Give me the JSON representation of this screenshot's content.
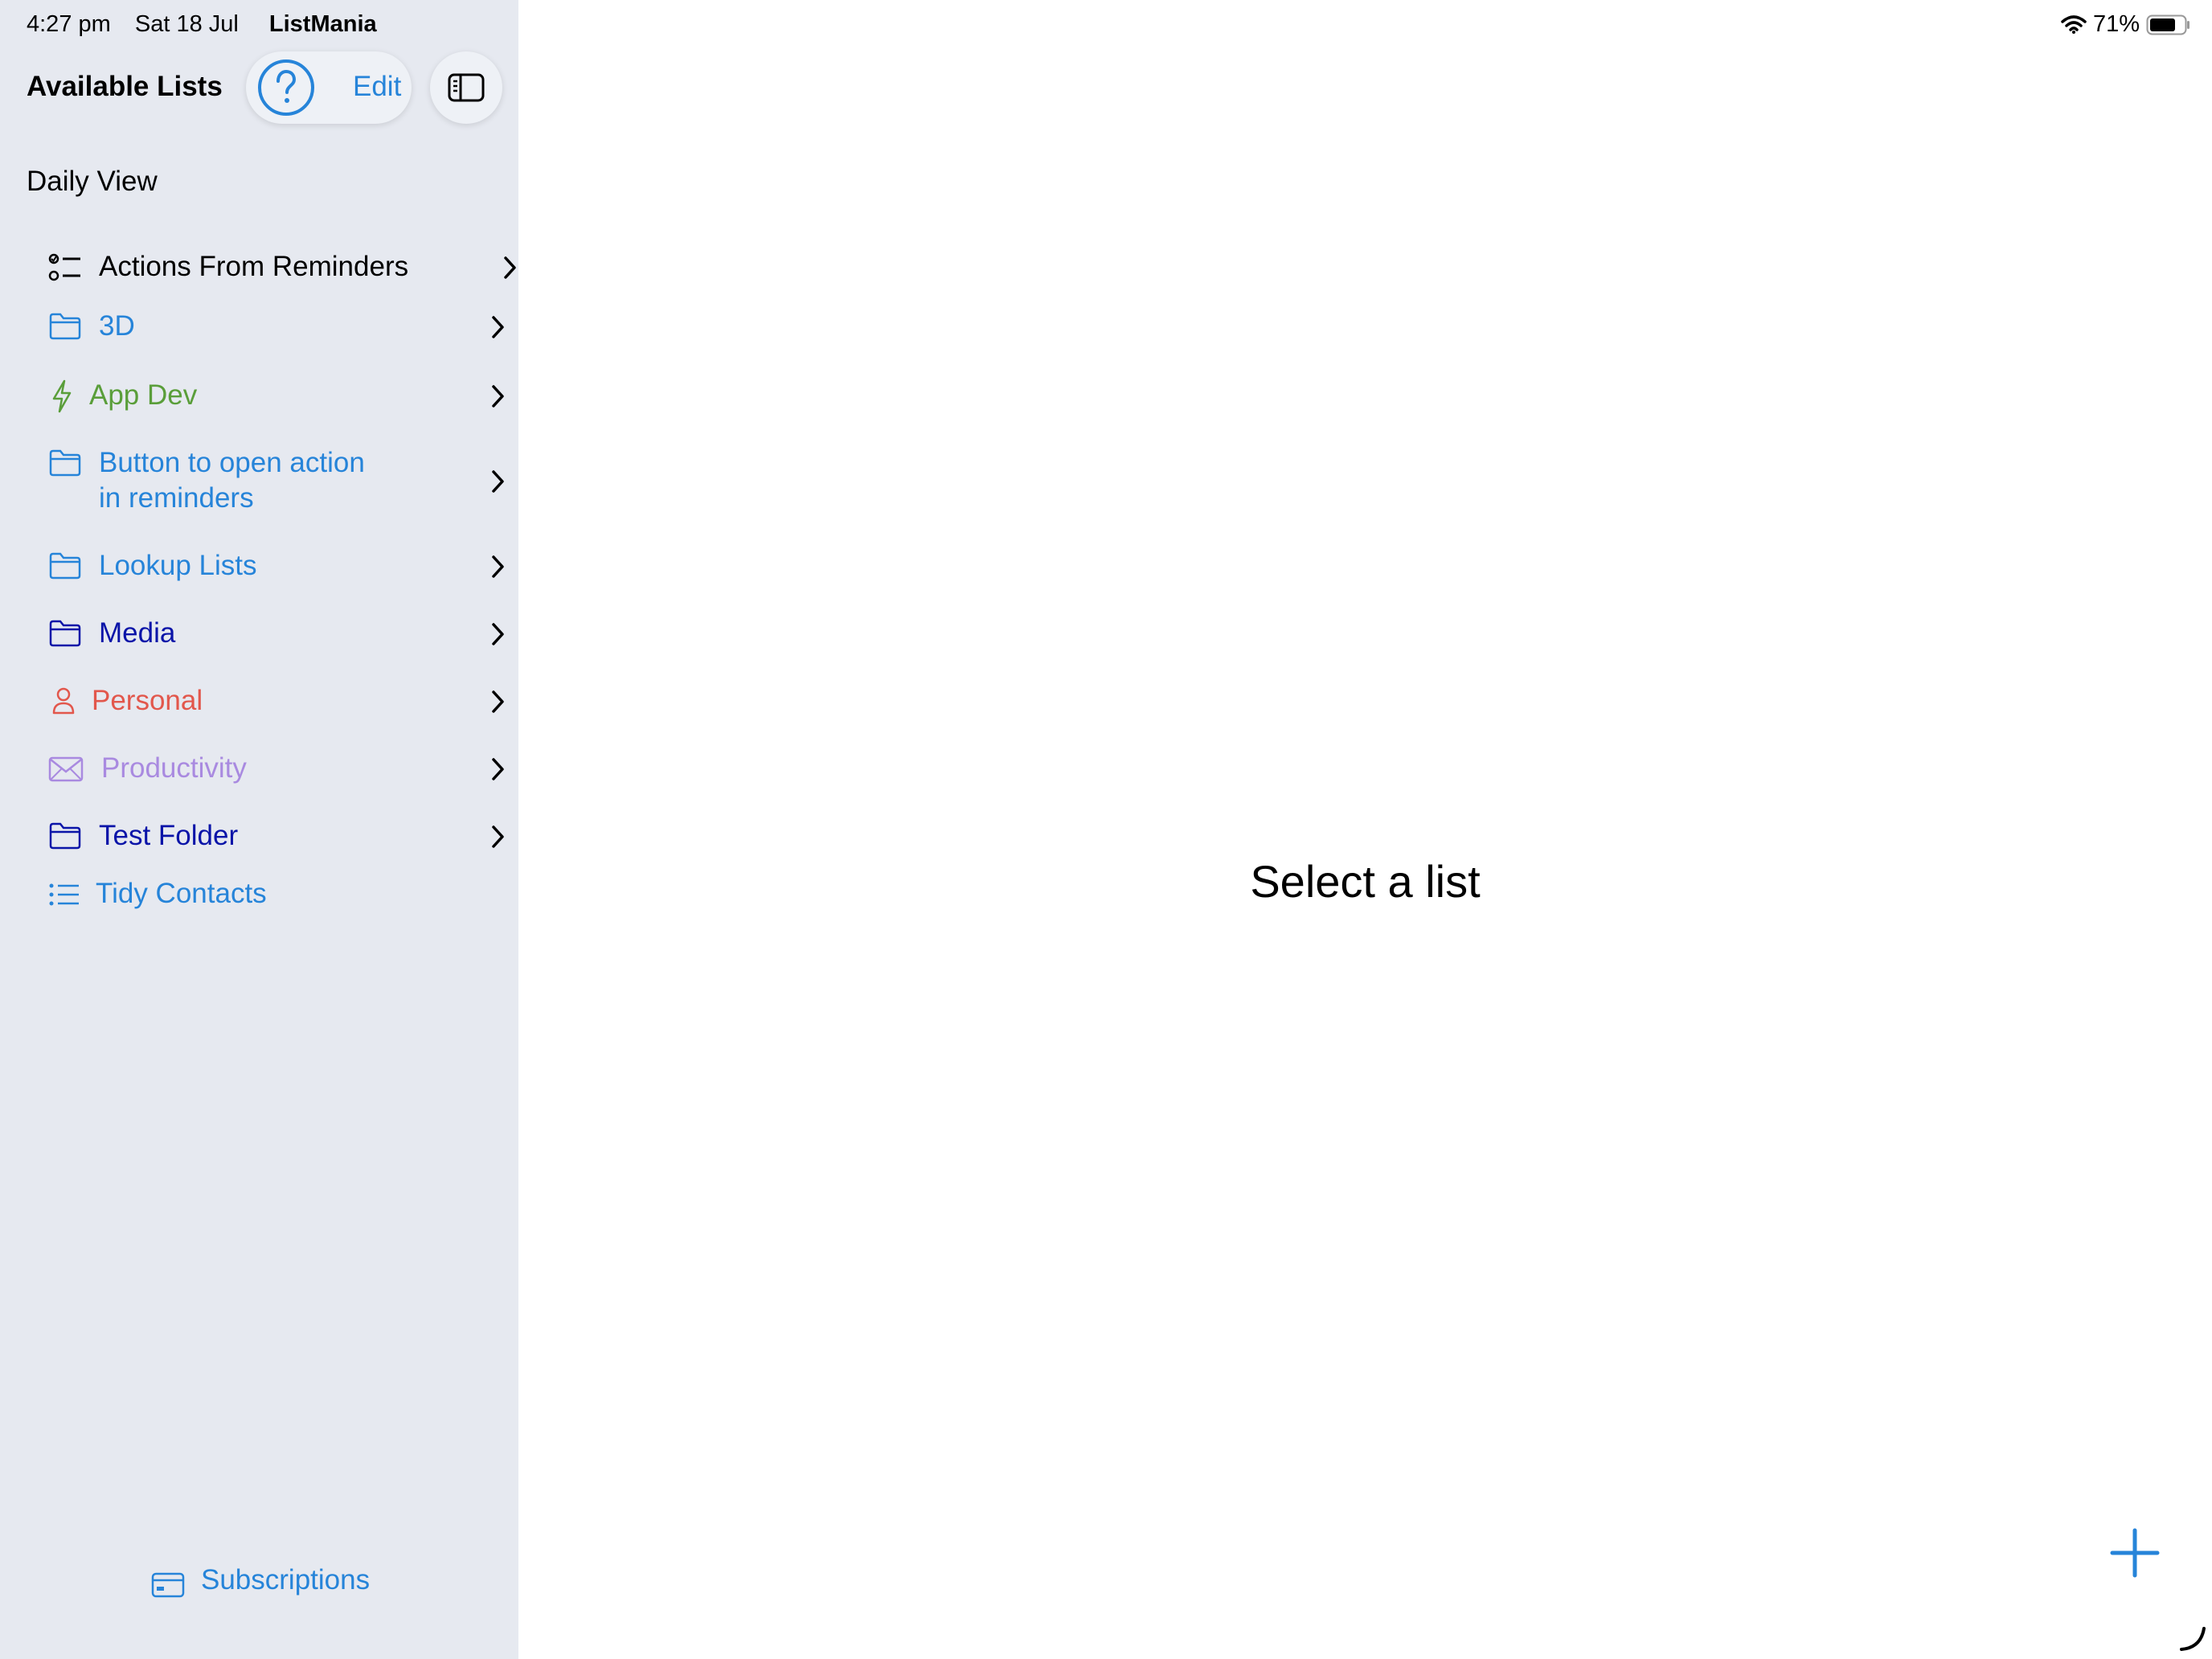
{
  "status_bar": {
    "time": "4:27 pm",
    "date": "Sat 18 Jul",
    "app_name": "ListMania",
    "battery": "71%"
  },
  "sidebar": {
    "title": "Available Lists",
    "edit_label": "Edit",
    "section_header": "Daily View",
    "items": [
      {
        "label": "Actions From Reminders",
        "icon": "checklist-icon",
        "color": "#000000",
        "chevron": true
      },
      {
        "label": "3D",
        "icon": "folder-icon",
        "color": "#2684d9",
        "chevron": true
      },
      {
        "label": "App Dev",
        "icon": "bolt-icon",
        "color": "#5a9e3a",
        "chevron": true
      },
      {
        "label": "Button to open action\nin reminders",
        "icon": "folder-icon",
        "color": "#2684d9",
        "chevron": true
      },
      {
        "label": "Lookup Lists",
        "icon": "folder-icon",
        "color": "#2684d9",
        "chevron": true
      },
      {
        "label": "Media",
        "icon": "folder-icon",
        "color": "#0a14a8",
        "chevron": true
      },
      {
        "label": "Personal",
        "icon": "person-icon",
        "color": "#e2574c",
        "chevron": true
      },
      {
        "label": "Productivity",
        "icon": "envelope-icon",
        "color": "#a98ae0",
        "chevron": true
      },
      {
        "label": "Test Folder",
        "icon": "folder-icon",
        "color": "#0a14a8",
        "chevron": true
      },
      {
        "label": "Tidy Contacts",
        "icon": "list-icon",
        "color": "#2684d9",
        "chevron": false
      }
    ],
    "subscriptions_label": "Subscriptions"
  },
  "main": {
    "empty_text": "Select a list"
  },
  "colors": {
    "accent": "#2684d9",
    "sidebar_bg": "#e6e9f0"
  }
}
